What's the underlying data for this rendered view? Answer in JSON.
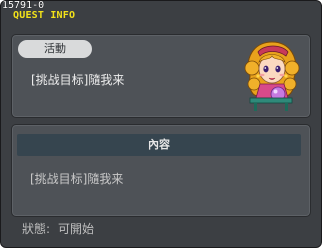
{
  "quest_id": "15791-0",
  "window_title": "QUEST INFO",
  "top_panel": {
    "tag": "活動",
    "mission": "[挑战目标]隨我来",
    "npc_icon": "npc-portrait-girl-with-crystal-ball"
  },
  "content_panel": {
    "header": "內容",
    "text": "[挑战目标]隨我来"
  },
  "status": {
    "label": "狀態:",
    "value": "可開始"
  },
  "colors": {
    "title": "#f2e21a",
    "window_bg": "#3c3f43",
    "panel_bg": "#4e5257",
    "header_bg": "#36454f"
  }
}
